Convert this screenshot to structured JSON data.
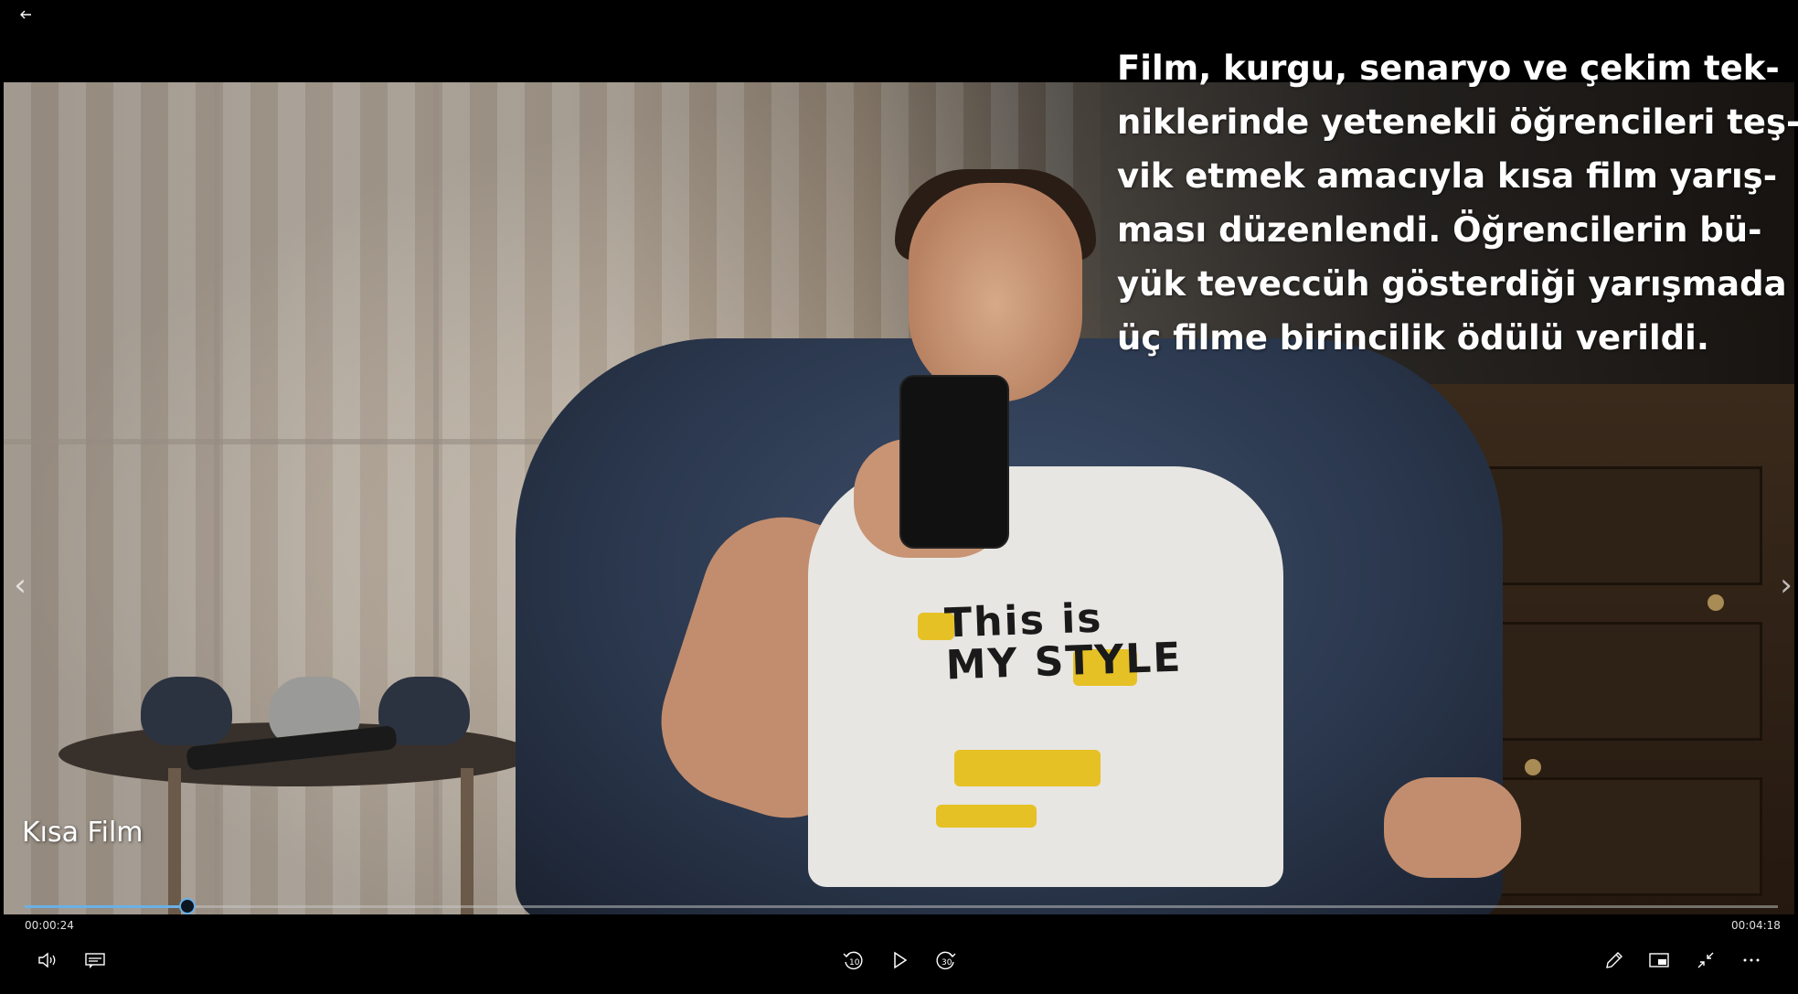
{
  "window": {
    "back_label": "←"
  },
  "overlay": {
    "caption_lines": [
      "Film, kurgu, senaryo ve çekim tek-",
      "niklerinde yetenekli öğrencileri teş-",
      "vik etmek amacıyla kısa film yarış-",
      "ması düzenlendi. Öğrencilerin bü-",
      "yük teveccüh gösterdiği yarışmada",
      "üç filme birincilik ödülü verildi."
    ],
    "video_title": "Kısa Film",
    "shirt_print": [
      "This is",
      "MY STYLE"
    ]
  },
  "navigation": {
    "prev_glyph": "‹",
    "next_glyph": "›"
  },
  "playback": {
    "current_time": "00:00:24",
    "total_time": "00:04:18",
    "progress_fraction": 0.093,
    "skip_back_seconds": "10",
    "skip_forward_seconds": "30"
  },
  "icons": {
    "volume": "volume-icon",
    "subtitles": "subtitles-icon",
    "skip_back": "skip-back-10-icon",
    "play": "play-icon",
    "skip_forward": "skip-forward-30-icon",
    "edit": "pencil-icon",
    "mini_view": "mini-view-icon",
    "exit_fullscreen": "exit-fullscreen-icon",
    "more": "more-icon"
  },
  "colors": {
    "accent": "#6ab0e6",
    "background": "#000000",
    "text": "#ffffff"
  }
}
